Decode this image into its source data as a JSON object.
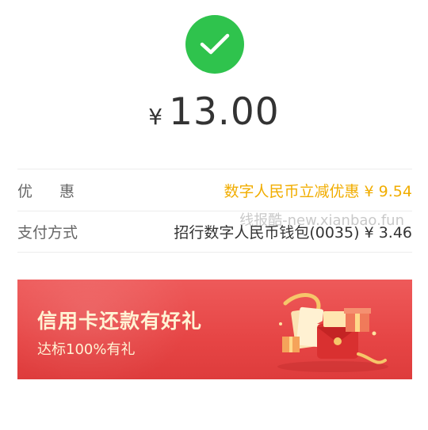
{
  "payment": {
    "currency_symbol": "¥",
    "amount": "13.00"
  },
  "details": {
    "discount_label": "优惠",
    "discount_value": "数字人民币立减优惠 ¥ 9.54",
    "payment_method_label": "支付方式",
    "payment_method_value": "招行数字人民币钱包(0035) ¥ 3.46"
  },
  "watermark": "线报酷-new.xianbao.fun",
  "banner": {
    "title": "信用卡还款有好礼",
    "subtitle": "达标100%有礼"
  },
  "colors": {
    "success_green": "#2fc34d",
    "discount_gold": "#f1ad00",
    "banner_red": "#e64545"
  },
  "icons": {
    "success": "check-circle-icon",
    "banner_art": "gift-envelope-illustration"
  }
}
